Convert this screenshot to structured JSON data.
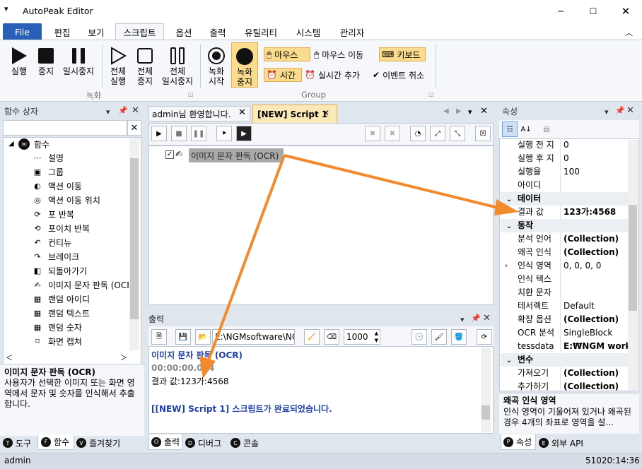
{
  "window": {
    "title": "AutoPeak Editor"
  },
  "menu": {
    "file": "File",
    "tabs": [
      "편집",
      "보기",
      "스크립트",
      "옵션",
      "출력",
      "유틸리티",
      "시스템",
      "관리자"
    ]
  },
  "ribbon": {
    "run": "실행",
    "stop": "중지",
    "pause": "일시중지",
    "run_all": "전체\n실행",
    "stop_all": "전체\n중지",
    "pause_all": "전체\n일시중지",
    "rec_start": "녹화\n시작",
    "rec_stop": "녹화\n중지",
    "mouse": "마우스",
    "mouse_move": "마우스 이동",
    "keyboard": "키보드",
    "time": "시간",
    "realtime_add": "실시간 추가",
    "event_cancel": "이벤트 취소",
    "group_record": "녹화",
    "group_group": "Group"
  },
  "func_panel": {
    "title": "함수 상자",
    "root": "함수",
    "items": [
      "설명",
      "그룹",
      "액션 이동",
      "액션 이동 위치",
      "포 반복",
      "포이치 반복",
      "컨티뉴",
      "브레이크",
      "되돌아가기",
      "이미지 문자 판독 (OCR)",
      "랜덤 아이디",
      "랜덤 텍스트",
      "랜덤 숫자",
      "화면 캡쳐"
    ],
    "desc_title": "이미지 문자 판독 (OCR)",
    "desc_text": "사용자가 선택한 이미지 또는 화면 영역에서 문자 및 숫자를 인식해서 추출합니다.",
    "tabs": [
      "도구",
      "함수",
      "즐겨찾기"
    ],
    "tab_keys": [
      "T",
      "F",
      "V"
    ]
  },
  "editor": {
    "tabs": [
      "admin님 환영합니다.",
      "[NEW] Script 1"
    ],
    "node": "이미지 문자 판독 (OCR)"
  },
  "output": {
    "title": "출력",
    "path": "E:\\NGMsoftware\\NG",
    "count": "1000",
    "line1": "이미지 문자 판독 (OCR)",
    "line2": "00:00:00.094",
    "line3": "결과 값:123가:4568",
    "line4": "[[NEW] Script 1] 스크립트가 완료되었습니다.",
    "tabs": [
      "출력",
      "디버그",
      "콘솔"
    ],
    "tab_keys": [
      "O",
      "D",
      "C"
    ]
  },
  "props": {
    "title": "속성",
    "rows1": [
      {
        "n": "실행 전 지",
        "v": "0"
      },
      {
        "n": "실행 후 지",
        "v": "0"
      },
      {
        "n": "실행율",
        "v": "100"
      },
      {
        "n": "아이디",
        "v": ""
      }
    ],
    "cat_data": "데이터",
    "result": {
      "n": "결과 값",
      "v": "123가:4568"
    },
    "cat_action": "동작",
    "rows2": [
      {
        "n": "분석 언어",
        "v": "(Collection)"
      },
      {
        "n": "왜곡 인식",
        "v": "(Collection)"
      },
      {
        "n": "인식 영역",
        "v": "0, 0, 0, 0"
      },
      {
        "n": "인식 텍스",
        "v": ""
      },
      {
        "n": "치환 문자",
        "v": ""
      },
      {
        "n": "테서렉트",
        "v": "Default"
      },
      {
        "n": "확장 옵션",
        "v": "(Collection)"
      },
      {
        "n": "OCR 분석",
        "v": "SingleBlock"
      },
      {
        "n": "tessdata",
        "v": "E:₩NGM work p"
      }
    ],
    "cat_var": "변수",
    "rows3": [
      {
        "n": "가져오기",
        "v": "(Collection)"
      },
      {
        "n": "추가하기",
        "v": "(Collection)"
      }
    ],
    "desc_title": "왜곡 인식 영역",
    "desc_text": "인식 영역이 기울어져 있거나 왜곡된 경우 4개의 좌표로 영역을 설...",
    "tabs": [
      "속성",
      "외부 API"
    ],
    "tab_keys": [
      "P",
      "E"
    ]
  },
  "status": {
    "user": "admin",
    "time": "51020:14:36"
  },
  "colors": {
    "accent": "#2a5fb7",
    "arrow": "#f28a2e",
    "highlight": "#fbdc8e"
  }
}
